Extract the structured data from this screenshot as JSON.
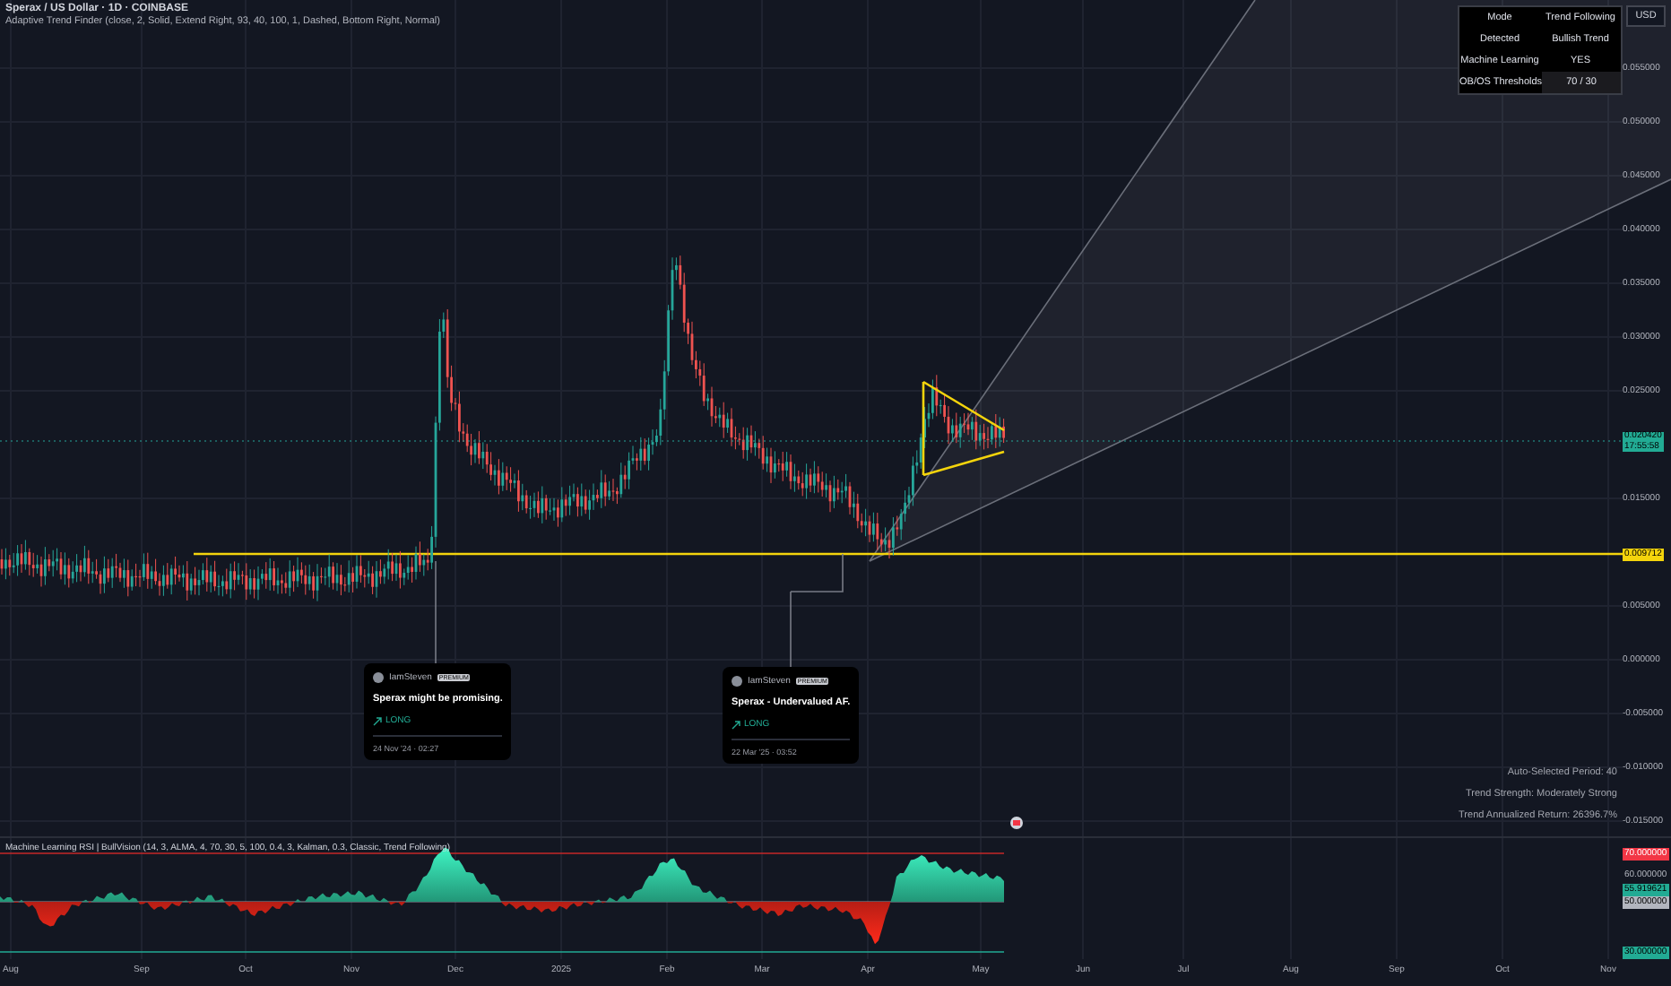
{
  "header": {
    "title": "Sperax / US Dollar · 1D · COINBASE",
    "indicator": "Adaptive Trend Finder (close, 2, Solid, Extend Right, 93, 40, 100, 1, Dashed, Bottom Right, Normal)"
  },
  "currency": "USD",
  "info_table": [
    {
      "label": "Mode",
      "value": "Trend Following"
    },
    {
      "label": "Detected",
      "value": "Bullish Trend"
    },
    {
      "label": "Machine Learning",
      "value": "YES"
    },
    {
      "label": "OB/OS Thresholds",
      "value": "70 / 30"
    }
  ],
  "price_axis": [
    "0.055000",
    "0.050000",
    "0.045000",
    "0.040000",
    "0.035000",
    "0.030000",
    "0.025000",
    "0.015000",
    "0.005000",
    "0.000000",
    "-0.005000",
    "-0.010000",
    "-0.015000"
  ],
  "price_badges": [
    {
      "kind": "last",
      "price": "0.020420",
      "timer": "17:55:58"
    },
    {
      "kind": "level",
      "price": "0.009712"
    }
  ],
  "ideas": [
    {
      "author": "IamSteven",
      "badge": "PREMIUM",
      "text": "Sperax might be promising.",
      "direction": "LONG",
      "time": "24 Nov '24 · 02:27"
    },
    {
      "author": "IamSteven",
      "badge": "PREMIUM",
      "text": "Sperax - Undervalued AF.",
      "direction": "LONG",
      "time": "22 Mar '25 · 03:52"
    }
  ],
  "stats": [
    "Auto-Selected Period: 40",
    "Trend Strength: Moderately Strong",
    "Trend Annualized Return: 26396.7%"
  ],
  "rsi_pane": {
    "title": "Machine Learning RSI | BullVision (14, 3, ALMA, 4, 70, 30, 5, 100, 0.4, 3, Kalman, 0.3, Classic, Trend Following)",
    "axis": [
      {
        "kind": "upper",
        "label": "70.000000"
      },
      {
        "kind": "tick",
        "label": "60.000000"
      },
      {
        "kind": "value",
        "label": "55.919621"
      },
      {
        "kind": "mid",
        "label": "50.000000"
      },
      {
        "kind": "lower",
        "label": "30.000000"
      }
    ]
  },
  "time_axis": [
    "Aug",
    "Sep",
    "Oct",
    "Nov",
    "Dec",
    "2025",
    "Feb",
    "Mar",
    "Apr",
    "May",
    "Jun",
    "Jul",
    "Aug",
    "Sep",
    "Oct",
    "Nov"
  ]
}
